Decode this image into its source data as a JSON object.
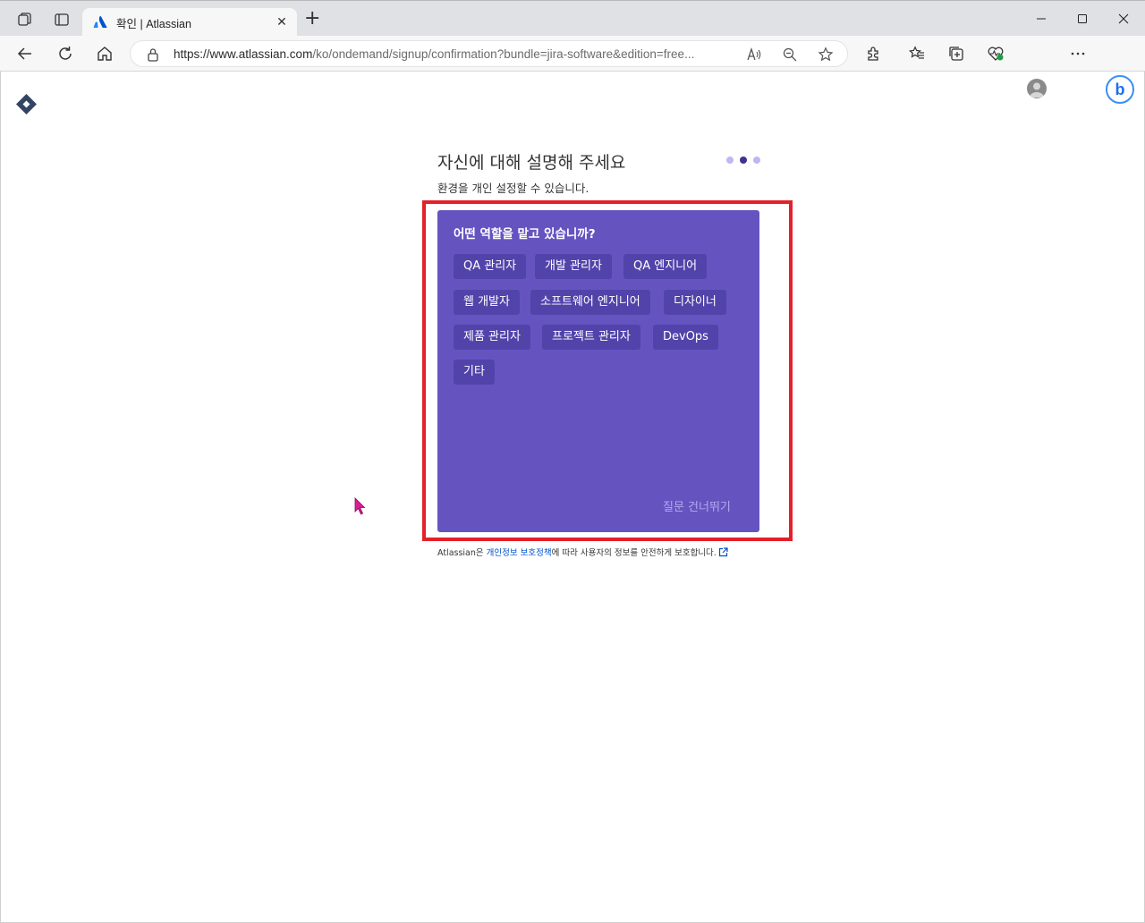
{
  "browser": {
    "tab_title": "확인 | Atlassian",
    "url_main": "https://www.atlassian.com",
    "url_rest": "/ko/ondemand/signup/confirmation?bundle=jira-software&edition=free..."
  },
  "page": {
    "heading": "자신에 대해 설명해 주세요",
    "subheading": "환경을 개인 설정할 수 있습니다.",
    "question": "어떤 역할을 맡고 있습니까?",
    "roles": [
      "QA 관리자",
      "개발 관리자",
      "QA 엔지니어",
      "웹 개발자",
      "소프트웨어 엔지니어",
      "디자이너",
      "제품 관리자",
      "프로젝트 관리자",
      "DevOps",
      "기타"
    ],
    "skip": "질문 건너뛰기",
    "footer_prefix": "Atlassian은 ",
    "footer_link": "개인정보 보호정책",
    "footer_suffix": "에 따라 사용자의 정보를 안전하게 보호합니다."
  },
  "colors": {
    "card": "#6554c0",
    "chip": "#5243aa",
    "highlight": "#e4202a",
    "link": "#0052cc"
  },
  "step_dots": {
    "count": 3,
    "active": 2
  }
}
